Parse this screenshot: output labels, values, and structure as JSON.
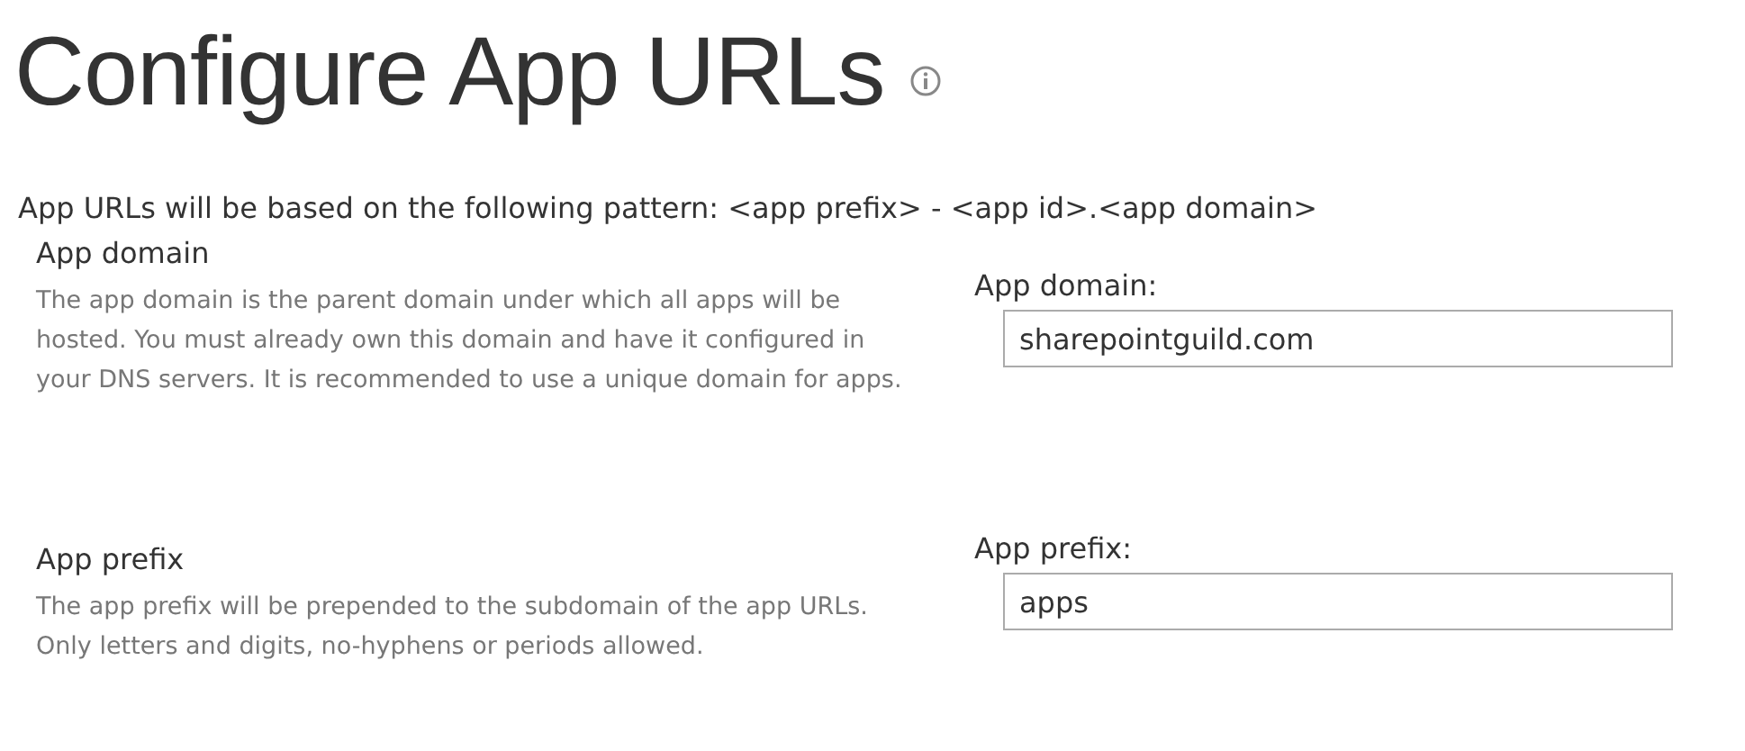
{
  "page": {
    "title": "Configure App URLs",
    "intro": "App URLs will be based on the following pattern: <app prefix> - <app id>.<app domain>"
  },
  "sections": [
    {
      "heading": "App domain",
      "description": "The app domain is the parent domain under which all apps will be hosted. You must already own this domain and have it configured in your DNS servers. It is recommended to use a unique domain for apps.",
      "field_label": "App domain:",
      "value": "sharepointguild.com"
    },
    {
      "heading": "App prefix",
      "description": "The app prefix will be prepended to the subdomain of the app URLs. Only letters and digits, no-hyphens or periods allowed.",
      "field_label": "App prefix:",
      "value": "apps"
    }
  ]
}
